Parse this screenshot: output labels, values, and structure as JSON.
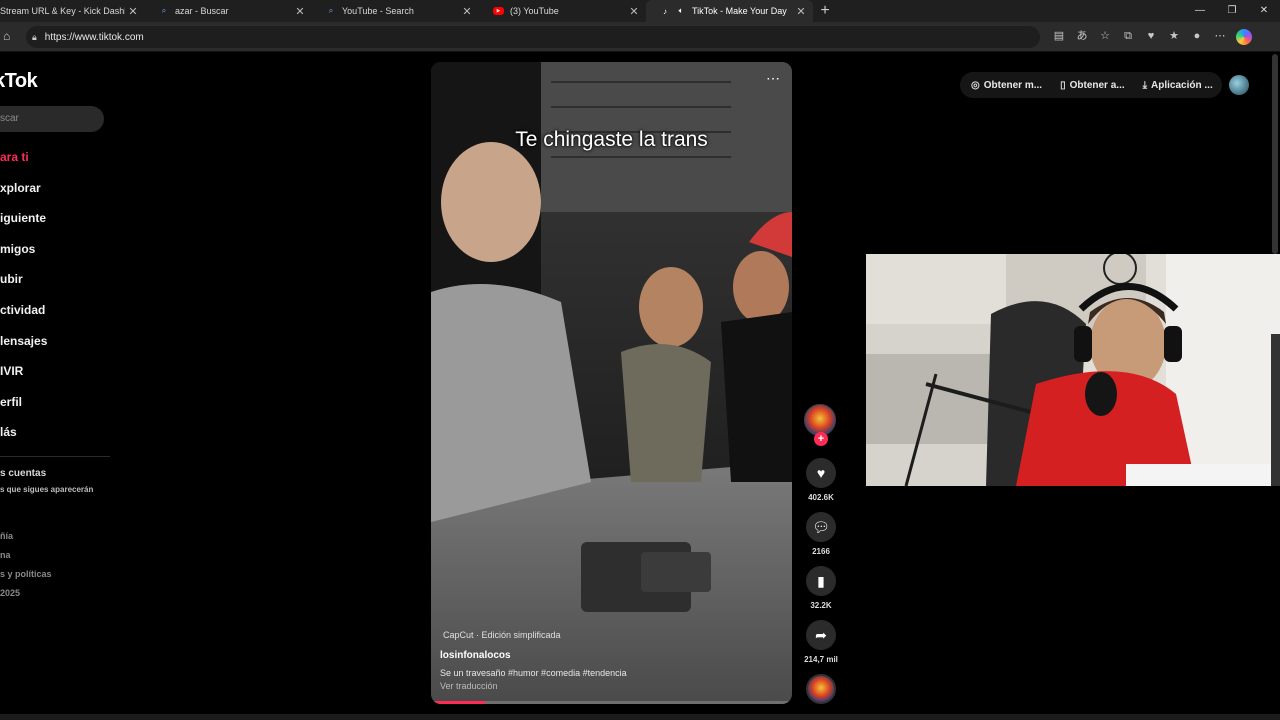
{
  "browser": {
    "tabs": [
      {
        "label": "Stream URL & Key - Kick Dashbo",
        "icon": "kick-icon",
        "active": false
      },
      {
        "label": "azar - Buscar",
        "icon": "search-icon",
        "active": false
      },
      {
        "label": "YouTube - Search",
        "icon": "search-icon",
        "active": false
      },
      {
        "label": "(3) YouTube",
        "icon": "youtube-icon",
        "active": false
      },
      {
        "label": "TikTok - Make Your Day",
        "icon": "tiktok-icon",
        "active": true
      }
    ],
    "url": "https://www.tiktok.com"
  },
  "sidebar": {
    "logo": "kTok",
    "search_placeholder": "scar",
    "nav": [
      {
        "label": "ara ti",
        "active": true
      },
      {
        "label": "xplorar",
        "active": false
      },
      {
        "label": "iguiente",
        "active": false
      },
      {
        "label": "migos",
        "active": false
      },
      {
        "label": "ubir",
        "active": false
      },
      {
        "label": "ctividad",
        "active": false
      },
      {
        "label": "lensajes",
        "active": false
      },
      {
        "label": "IVIR",
        "active": false
      },
      {
        "label": "erfil",
        "active": false
      },
      {
        "label": "lás",
        "active": false
      }
    ],
    "accounts_title": "s cuentas",
    "accounts_sub": "s que sigues aparecerán",
    "footer": [
      "ñía",
      "na",
      "s y políticas",
      "2025"
    ]
  },
  "topbar": {
    "pills": [
      {
        "label": "Obtener m...",
        "icon": "coin-icon"
      },
      {
        "label": "Obtener a...",
        "icon": "phone-icon"
      },
      {
        "label": "Aplicación ...",
        "icon": "download-icon"
      }
    ]
  },
  "video": {
    "caption": "Te chingaste la trans",
    "capcut": "CapCut · Edición simplificada",
    "author": "losinfonalocos",
    "description": "Se un travesaño #humor  #comedia  #tendencia",
    "translate": "Ver traducción",
    "progress_fraction": 0.15
  },
  "actions": {
    "likes": "402.6K",
    "comments": "2166",
    "saves": "32.2K",
    "shares": "214,7 mil"
  },
  "colors": {
    "accent": "#fe2c55",
    "background": "#000000"
  }
}
